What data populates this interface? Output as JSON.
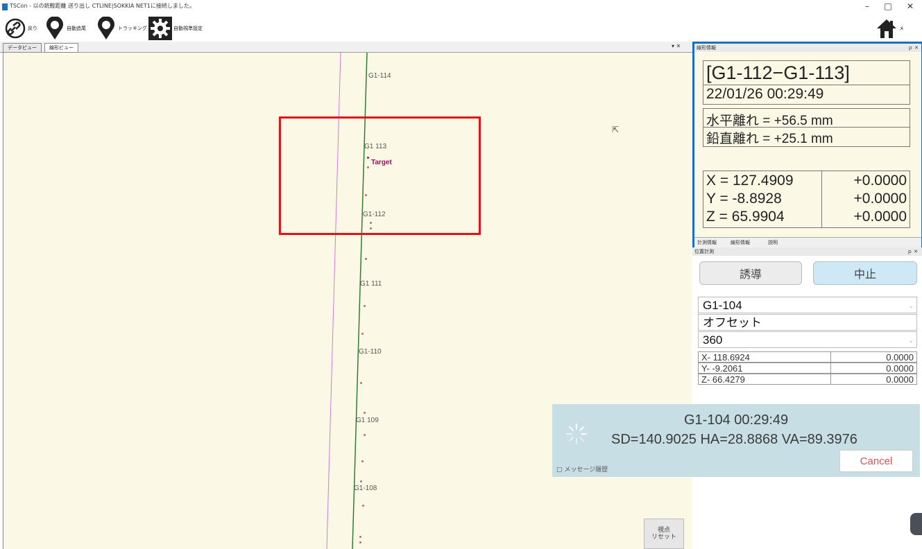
{
  "window": {
    "title": "TSCon - 以の銃鞍距離 送り出し CTLINE|SOKKIA NET1に接続しました。",
    "controls": [
      "–",
      "□",
      "✕"
    ]
  },
  "toolbar": {
    "items": [
      {
        "label": "戻り",
        "icon": "link-icon"
      },
      {
        "label": "自動追尾",
        "icon": "map-pin-icon"
      },
      {
        "label": "トラッキング",
        "icon": "map-pin-icon"
      },
      {
        "label": "自動視準設定",
        "icon": "gear-icon"
      }
    ],
    "home_label": "メ"
  },
  "map": {
    "tabs": [
      "データビュー",
      "線形ビュー"
    ],
    "controls": "▾ ✕",
    "points": [
      {
        "label": "G1-114"
      },
      {
        "label": "G1 113"
      },
      {
        "label": "Target"
      },
      {
        "label": "G1-112"
      },
      {
        "label": "G1 111"
      },
      {
        "label": "G1-110"
      },
      {
        "label": "G1 109"
      },
      {
        "label": "G1-108"
      }
    ],
    "reset_button": "視点\nリセット"
  },
  "info_panel": {
    "header": "線形情報",
    "header_controls": "ｐ ✕",
    "segment": "[G1-112−G1-113]",
    "datetime": "22/01/26 00:29:49",
    "horizontal_offset": "水平離れ = +56.5 mm",
    "vertical_offset": "鉛直離れ = +25.1 mm",
    "coords": [
      {
        "label": "X = 127.4909",
        "delta": "+0.0000"
      },
      {
        "label": "Y = -8.8928",
        "delta": "+0.0000"
      },
      {
        "label": "Z = 65.9904",
        "delta": "+0.0000"
      }
    ],
    "tabs": [
      "計測情報",
      "線形情報",
      "説明"
    ]
  },
  "position_panel": {
    "header": "位置計測",
    "header_controls": "ｐ ✕",
    "guide_button": "誘導",
    "stop_button": "中止",
    "point_select": "G1-104",
    "mode_field": "オフセット",
    "prism_select": "360",
    "coords": [
      {
        "label": "X- 118.6924",
        "value": "0.0000"
      },
      {
        "label": "Y- -9.2061",
        "value": "0.0000"
      },
      {
        "label": "Z- 66.4279",
        "value": "0.0000"
      }
    ]
  },
  "toast": {
    "line1": "G1-104 00:29:49",
    "line2": "SD=140.9025 HA=28.8868 VA=89.3976",
    "cancel": "Cancel",
    "checkbox_label": "メッセージ履歴"
  },
  "colors": {
    "map_bg": "#fbf9e6",
    "alignment_line": "#2e7d32",
    "reference_line": "#d07ad6",
    "highlight": "#e0141b",
    "panel_border": "#1b6fc1",
    "stop_button": "#cfe8f5",
    "toast_bg": "#c5dde4"
  }
}
